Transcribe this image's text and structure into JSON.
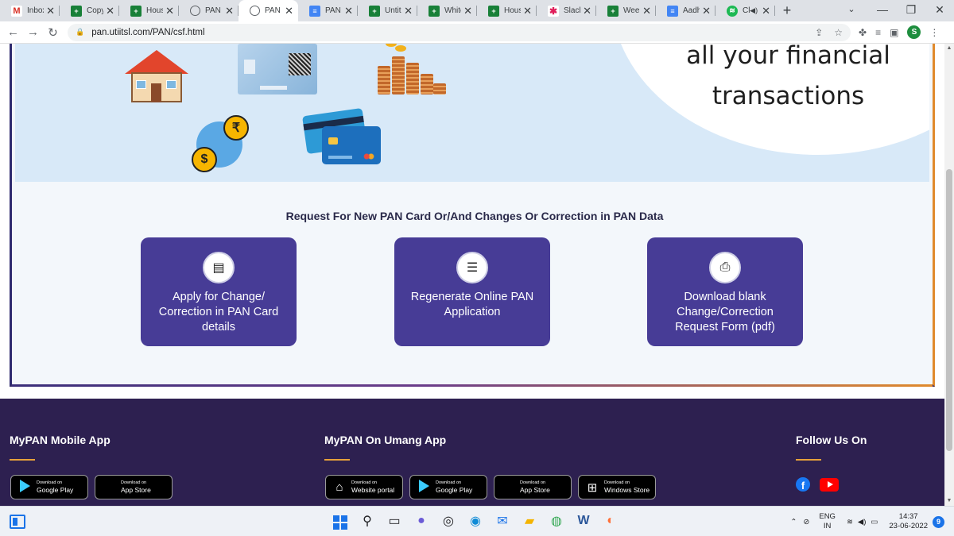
{
  "browser": {
    "tabs": [
      {
        "title": "Inbox",
        "favicon": "gmail-icon",
        "active": false
      },
      {
        "title": "Copy",
        "favicon": "sheets-icon",
        "active": false
      },
      {
        "title": "Housi",
        "favicon": "sheets-icon",
        "active": false
      },
      {
        "title": "PAN C",
        "favicon": "globe-icon",
        "active": false
      },
      {
        "title": "PAN C",
        "favicon": "globe-icon",
        "active": true
      },
      {
        "title": "PAN C",
        "favicon": "docs-icon",
        "active": false
      },
      {
        "title": "Untitl",
        "favicon": "sheets-icon",
        "active": false
      },
      {
        "title": "White",
        "favicon": "sheets-icon",
        "active": false
      },
      {
        "title": "Housi",
        "favicon": "sheets-icon",
        "active": false
      },
      {
        "title": "Slack",
        "favicon": "slack-icon",
        "active": false
      },
      {
        "title": "Week",
        "favicon": "sheets-icon",
        "active": false
      },
      {
        "title": "Aadh",
        "favicon": "docs-icon",
        "active": false
      },
      {
        "title": "Cl",
        "favicon": "spotify-icon",
        "active": false
      }
    ],
    "new_tab_glyph": "+",
    "url": "pan.utiitsl.com/PAN/csf.html",
    "profile_initial": "S"
  },
  "banner": {
    "line1": "all your financial",
    "line2": "transactions"
  },
  "section": {
    "title": "Request For New PAN Card Or/And Changes Or Correction in PAN Data",
    "tiles": [
      {
        "icon": "id-card-icon",
        "label": "Apply for Change/ Correction in PAN Card details"
      },
      {
        "icon": "document-icon",
        "label": "Regenerate Online PAN Application"
      },
      {
        "icon": "pdf-icon",
        "label": "Download blank Change/Correction Request Form (pdf)"
      }
    ]
  },
  "footer": {
    "mypan_app": {
      "title": "MyPAN Mobile App",
      "stores": [
        {
          "icon": "google-play-icon",
          "small": "Download on",
          "big": "Google Play"
        },
        {
          "icon": "apple-icon",
          "small": "Download on",
          "big": "App Store"
        }
      ]
    },
    "umang": {
      "title": "MyPAN On Umang App",
      "stores": [
        {
          "icon": "website-icon",
          "small": "Download on",
          "big": "Website portal"
        },
        {
          "icon": "google-play-icon",
          "small": "Download on",
          "big": "Google Play"
        },
        {
          "icon": "apple-icon",
          "small": "Download on",
          "big": "App Store"
        },
        {
          "icon": "windows-icon",
          "small": "Download on",
          "big": "Windows Store"
        }
      ]
    },
    "follow": {
      "title": "Follow Us On",
      "networks": [
        "facebook-icon",
        "youtube-icon"
      ]
    }
  },
  "taskbar": {
    "lang_line1": "ENG",
    "lang_line2": "IN",
    "time": "14:37",
    "date": "23-06-2022",
    "notification_count": "9"
  },
  "colors": {
    "tile_bg": "#473c96",
    "footer_bg": "#2d2050",
    "accent_orange": "#e6a13a",
    "banner_bg": "#d8e9f8"
  }
}
